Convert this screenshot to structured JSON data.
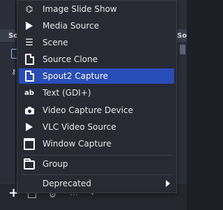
{
  "background": {
    "left_panel_header": "So",
    "right_panel_header": "So"
  },
  "menu": {
    "items": [
      {
        "label": "Image Slide Show",
        "icon": "slideshow-icon"
      },
      {
        "label": "Media Source",
        "icon": "play-icon"
      },
      {
        "label": "Scene",
        "icon": "list-icon"
      },
      {
        "label": "Source Clone",
        "icon": "document-icon"
      },
      {
        "label": "Spout2 Capture",
        "icon": "document-icon",
        "selected": true
      },
      {
        "label": "Text (GDI+)",
        "icon": "text-icon"
      },
      {
        "label": "Video Capture Device",
        "icon": "camera-icon"
      },
      {
        "label": "VLC Video Source",
        "icon": "play-icon"
      },
      {
        "label": "Window Capture",
        "icon": "window-icon"
      }
    ],
    "group_label": "Group",
    "deprecated_label": "Deprecated"
  },
  "toolbar": {
    "add_symbol": "+"
  },
  "colors": {
    "selected_bg": "#284cb8",
    "menu_bg": "#272a33",
    "app_bg": "#1d1f26"
  }
}
